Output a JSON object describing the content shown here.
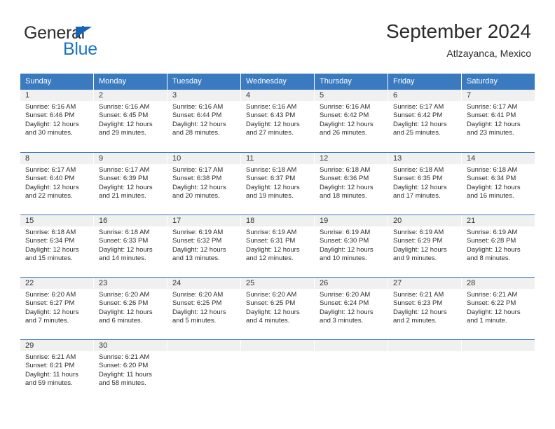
{
  "brand": {
    "name_top": "General",
    "name_bottom": "Blue",
    "triangle_color": "#1565b5",
    "blue_color": "#1873c4"
  },
  "header": {
    "title": "September 2024",
    "subtitle": "Atlzayanca, Mexico"
  },
  "theme": {
    "header_blue": "#3a7ac0",
    "day_number_band": "#f0f0f0",
    "text": "#2d2d2d"
  },
  "weekdays": [
    "Sunday",
    "Monday",
    "Tuesday",
    "Wednesday",
    "Thursday",
    "Friday",
    "Saturday"
  ],
  "weeks": [
    [
      {
        "day": "1",
        "sunrise": "Sunrise: 6:16 AM",
        "sunset": "Sunset: 6:46 PM",
        "daylight": "Daylight: 12 hours and 30 minutes."
      },
      {
        "day": "2",
        "sunrise": "Sunrise: 6:16 AM",
        "sunset": "Sunset: 6:45 PM",
        "daylight": "Daylight: 12 hours and 29 minutes."
      },
      {
        "day": "3",
        "sunrise": "Sunrise: 6:16 AM",
        "sunset": "Sunset: 6:44 PM",
        "daylight": "Daylight: 12 hours and 28 minutes."
      },
      {
        "day": "4",
        "sunrise": "Sunrise: 6:16 AM",
        "sunset": "Sunset: 6:43 PM",
        "daylight": "Daylight: 12 hours and 27 minutes."
      },
      {
        "day": "5",
        "sunrise": "Sunrise: 6:16 AM",
        "sunset": "Sunset: 6:42 PM",
        "daylight": "Daylight: 12 hours and 26 minutes."
      },
      {
        "day": "6",
        "sunrise": "Sunrise: 6:17 AM",
        "sunset": "Sunset: 6:42 PM",
        "daylight": "Daylight: 12 hours and 25 minutes."
      },
      {
        "day": "7",
        "sunrise": "Sunrise: 6:17 AM",
        "sunset": "Sunset: 6:41 PM",
        "daylight": "Daylight: 12 hours and 23 minutes."
      }
    ],
    [
      {
        "day": "8",
        "sunrise": "Sunrise: 6:17 AM",
        "sunset": "Sunset: 6:40 PM",
        "daylight": "Daylight: 12 hours and 22 minutes."
      },
      {
        "day": "9",
        "sunrise": "Sunrise: 6:17 AM",
        "sunset": "Sunset: 6:39 PM",
        "daylight": "Daylight: 12 hours and 21 minutes."
      },
      {
        "day": "10",
        "sunrise": "Sunrise: 6:17 AM",
        "sunset": "Sunset: 6:38 PM",
        "daylight": "Daylight: 12 hours and 20 minutes."
      },
      {
        "day": "11",
        "sunrise": "Sunrise: 6:18 AM",
        "sunset": "Sunset: 6:37 PM",
        "daylight": "Daylight: 12 hours and 19 minutes."
      },
      {
        "day": "12",
        "sunrise": "Sunrise: 6:18 AM",
        "sunset": "Sunset: 6:36 PM",
        "daylight": "Daylight: 12 hours and 18 minutes."
      },
      {
        "day": "13",
        "sunrise": "Sunrise: 6:18 AM",
        "sunset": "Sunset: 6:35 PM",
        "daylight": "Daylight: 12 hours and 17 minutes."
      },
      {
        "day": "14",
        "sunrise": "Sunrise: 6:18 AM",
        "sunset": "Sunset: 6:34 PM",
        "daylight": "Daylight: 12 hours and 16 minutes."
      }
    ],
    [
      {
        "day": "15",
        "sunrise": "Sunrise: 6:18 AM",
        "sunset": "Sunset: 6:34 PM",
        "daylight": "Daylight: 12 hours and 15 minutes."
      },
      {
        "day": "16",
        "sunrise": "Sunrise: 6:18 AM",
        "sunset": "Sunset: 6:33 PM",
        "daylight": "Daylight: 12 hours and 14 minutes."
      },
      {
        "day": "17",
        "sunrise": "Sunrise: 6:19 AM",
        "sunset": "Sunset: 6:32 PM",
        "daylight": "Daylight: 12 hours and 13 minutes."
      },
      {
        "day": "18",
        "sunrise": "Sunrise: 6:19 AM",
        "sunset": "Sunset: 6:31 PM",
        "daylight": "Daylight: 12 hours and 12 minutes."
      },
      {
        "day": "19",
        "sunrise": "Sunrise: 6:19 AM",
        "sunset": "Sunset: 6:30 PM",
        "daylight": "Daylight: 12 hours and 10 minutes."
      },
      {
        "day": "20",
        "sunrise": "Sunrise: 6:19 AM",
        "sunset": "Sunset: 6:29 PM",
        "daylight": "Daylight: 12 hours and 9 minutes."
      },
      {
        "day": "21",
        "sunrise": "Sunrise: 6:19 AM",
        "sunset": "Sunset: 6:28 PM",
        "daylight": "Daylight: 12 hours and 8 minutes."
      }
    ],
    [
      {
        "day": "22",
        "sunrise": "Sunrise: 6:20 AM",
        "sunset": "Sunset: 6:27 PM",
        "daylight": "Daylight: 12 hours and 7 minutes."
      },
      {
        "day": "23",
        "sunrise": "Sunrise: 6:20 AM",
        "sunset": "Sunset: 6:26 PM",
        "daylight": "Daylight: 12 hours and 6 minutes."
      },
      {
        "day": "24",
        "sunrise": "Sunrise: 6:20 AM",
        "sunset": "Sunset: 6:25 PM",
        "daylight": "Daylight: 12 hours and 5 minutes."
      },
      {
        "day": "25",
        "sunrise": "Sunrise: 6:20 AM",
        "sunset": "Sunset: 6:25 PM",
        "daylight": "Daylight: 12 hours and 4 minutes."
      },
      {
        "day": "26",
        "sunrise": "Sunrise: 6:20 AM",
        "sunset": "Sunset: 6:24 PM",
        "daylight": "Daylight: 12 hours and 3 minutes."
      },
      {
        "day": "27",
        "sunrise": "Sunrise: 6:21 AM",
        "sunset": "Sunset: 6:23 PM",
        "daylight": "Daylight: 12 hours and 2 minutes."
      },
      {
        "day": "28",
        "sunrise": "Sunrise: 6:21 AM",
        "sunset": "Sunset: 6:22 PM",
        "daylight": "Daylight: 12 hours and 1 minute."
      }
    ],
    [
      {
        "day": "29",
        "sunrise": "Sunrise: 6:21 AM",
        "sunset": "Sunset: 6:21 PM",
        "daylight": "Daylight: 11 hours and 59 minutes."
      },
      {
        "day": "30",
        "sunrise": "Sunrise: 6:21 AM",
        "sunset": "Sunset: 6:20 PM",
        "daylight": "Daylight: 11 hours and 58 minutes."
      },
      {
        "day": "",
        "sunrise": "",
        "sunset": "",
        "daylight": ""
      },
      {
        "day": "",
        "sunrise": "",
        "sunset": "",
        "daylight": ""
      },
      {
        "day": "",
        "sunrise": "",
        "sunset": "",
        "daylight": ""
      },
      {
        "day": "",
        "sunrise": "",
        "sunset": "",
        "daylight": ""
      },
      {
        "day": "",
        "sunrise": "",
        "sunset": "",
        "daylight": ""
      }
    ]
  ]
}
